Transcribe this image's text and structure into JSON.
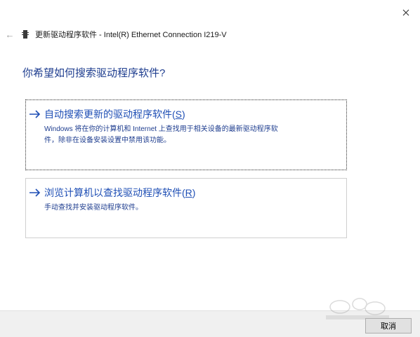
{
  "window": {
    "title": "更新驱动程序软件 - Intel(R) Ethernet Connection I219-V",
    "back_label": "←",
    "close_label": "×"
  },
  "main": {
    "heading": "你希望如何搜索驱动程序软件?",
    "options": [
      {
        "title_text": "自动搜索更新的驱动程序软件(",
        "title_key": "S",
        "title_end": ")",
        "description_line1": "Windows 将在你的计算机和 Internet 上查找用于相关设备的最新驱动程序软",
        "description_line2": "件，除非在设备安装设置中禁用该功能。"
      },
      {
        "title_text": "浏览计算机以查找驱动程序软件(",
        "title_key": "R",
        "title_end": ")",
        "description_line1": "手动查找并安装驱动程序软件。"
      }
    ]
  },
  "footer": {
    "cancel_label": "取消"
  },
  "colors": {
    "heading": "#1e3d8f",
    "link": "#1f4fb5",
    "arrow": "#1f4fb5"
  }
}
